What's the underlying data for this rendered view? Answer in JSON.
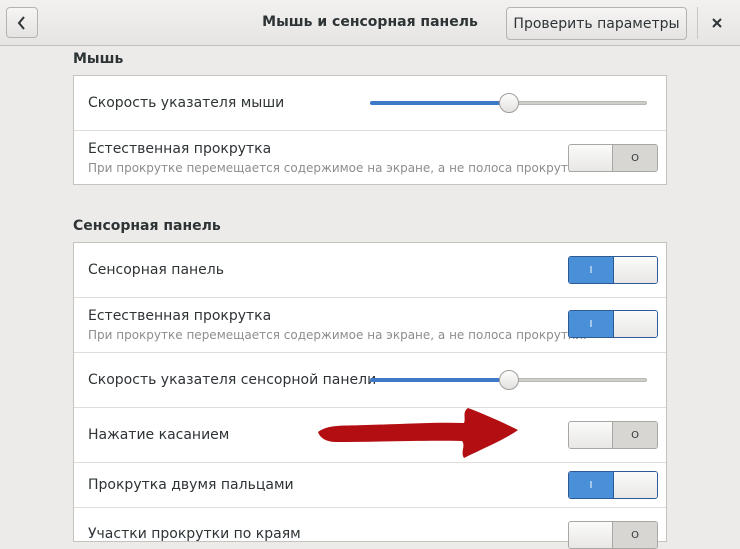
{
  "header": {
    "title": "Мышь и сенсорная панель",
    "check_button": "Проверить параметры",
    "back_icon": "chevron-left-icon",
    "close_icon": "close-icon"
  },
  "mouse": {
    "section_title": "Мышь",
    "pointer_speed_label": "Скорость указателя мыши",
    "pointer_speed_fraction": 0.5,
    "natural_scroll_label": "Естественная прокрутка",
    "natural_scroll_desc": "При прокрутке перемещается содержимое на экране, а не полоса прокрутки.",
    "natural_scroll_state": "O"
  },
  "touchpad": {
    "section_title": "Сенсорная панель",
    "enable_label": "Сенсорная панель",
    "enable_state": "I",
    "natural_scroll_label": "Естественная прокрутка",
    "natural_scroll_desc": "При прокрутке перемещается содержимое на экране, а не полоса прокрутки.",
    "natural_scroll_state": "I",
    "pointer_speed_label": "Скорость указателя сенсорной панели",
    "pointer_speed_fraction": 0.5,
    "tap_to_click_label": "Нажатие касанием",
    "tap_to_click_state": "O",
    "two_finger_label": "Прокрутка двумя пальцами",
    "two_finger_state": "I",
    "edge_scroll_label": "Участки прокрутки по краям",
    "edge_scroll_state": "O"
  },
  "colors": {
    "accent": "#4a90d9",
    "annotation_arrow": "#b30f12"
  }
}
